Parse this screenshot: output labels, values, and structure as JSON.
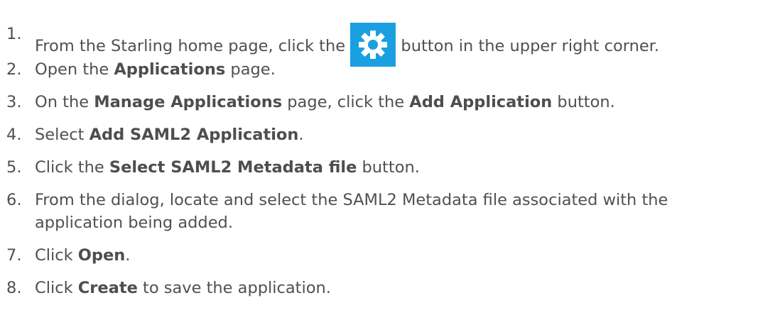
{
  "steps": [
    {
      "number": "1.",
      "before": "From the Starling home page, click the",
      "icon": "gear-icon",
      "after": "button in the upper right corner."
    },
    {
      "number": "2.",
      "before": "Open the",
      "bold": "Applications",
      "after": "page."
    },
    {
      "number": "3.",
      "before": "On the",
      "bold1": "Manage Applications",
      "middle": "page, click the",
      "bold2": "Add Application",
      "after": "button."
    },
    {
      "number": "4.",
      "before": "Select",
      "bold": "Add SAML2 Application",
      "after": "."
    },
    {
      "number": "5.",
      "before": "Click the",
      "bold": "Select SAML2 Metadata file",
      "after": "button."
    },
    {
      "number": "6.",
      "line1": "From the dialog, locate and select the SAML2 Metadata file associated with the",
      "line2": "application being added."
    },
    {
      "number": "7.",
      "before": "Click",
      "bold": "Open",
      "after": "."
    },
    {
      "number": "8.",
      "before": "Click",
      "bold": "Create",
      "after": "to save the application."
    }
  ],
  "colors": {
    "text": "#505050",
    "gear_button_bg": "#1aa0e0",
    "gear_fill": "#ffffff"
  }
}
